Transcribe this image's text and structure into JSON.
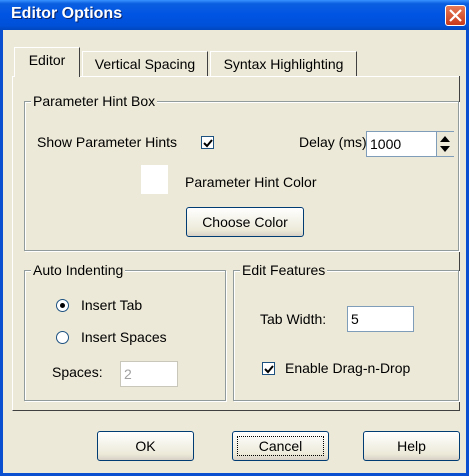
{
  "window": {
    "title": "Editor Options"
  },
  "tabs": [
    {
      "label": "Editor",
      "active": true
    },
    {
      "label": "Vertical Spacing",
      "active": false
    },
    {
      "label": "Syntax Highlighting",
      "active": false
    }
  ],
  "parameter_hint_box": {
    "title": "Parameter Hint Box",
    "show_hints_label": "Show Parameter Hints",
    "show_hints_checked": true,
    "delay_label": "Delay (ms):",
    "delay_value": "1000",
    "hint_color_label": "Parameter Hint Color",
    "hint_color": "#ffffff",
    "choose_color_label": "Choose Color"
  },
  "auto_indenting": {
    "title": "Auto Indenting",
    "insert_tab_label": "Insert Tab",
    "insert_spaces_label": "Insert Spaces",
    "selected": "Insert Tab",
    "spaces_label": "Spaces:",
    "spaces_value": "2"
  },
  "edit_features": {
    "title": "Edit Features",
    "tab_width_label": "Tab Width:",
    "tab_width_value": "5",
    "drag_drop_label": "Enable Drag-n-Drop",
    "drag_drop_checked": true
  },
  "buttons": {
    "ok": "OK",
    "cancel": "Cancel",
    "help": "Help"
  },
  "colors": {
    "title_bar": "#0054e3",
    "dialog_bg": "#ece9d8",
    "close_button": "#d9532c"
  }
}
